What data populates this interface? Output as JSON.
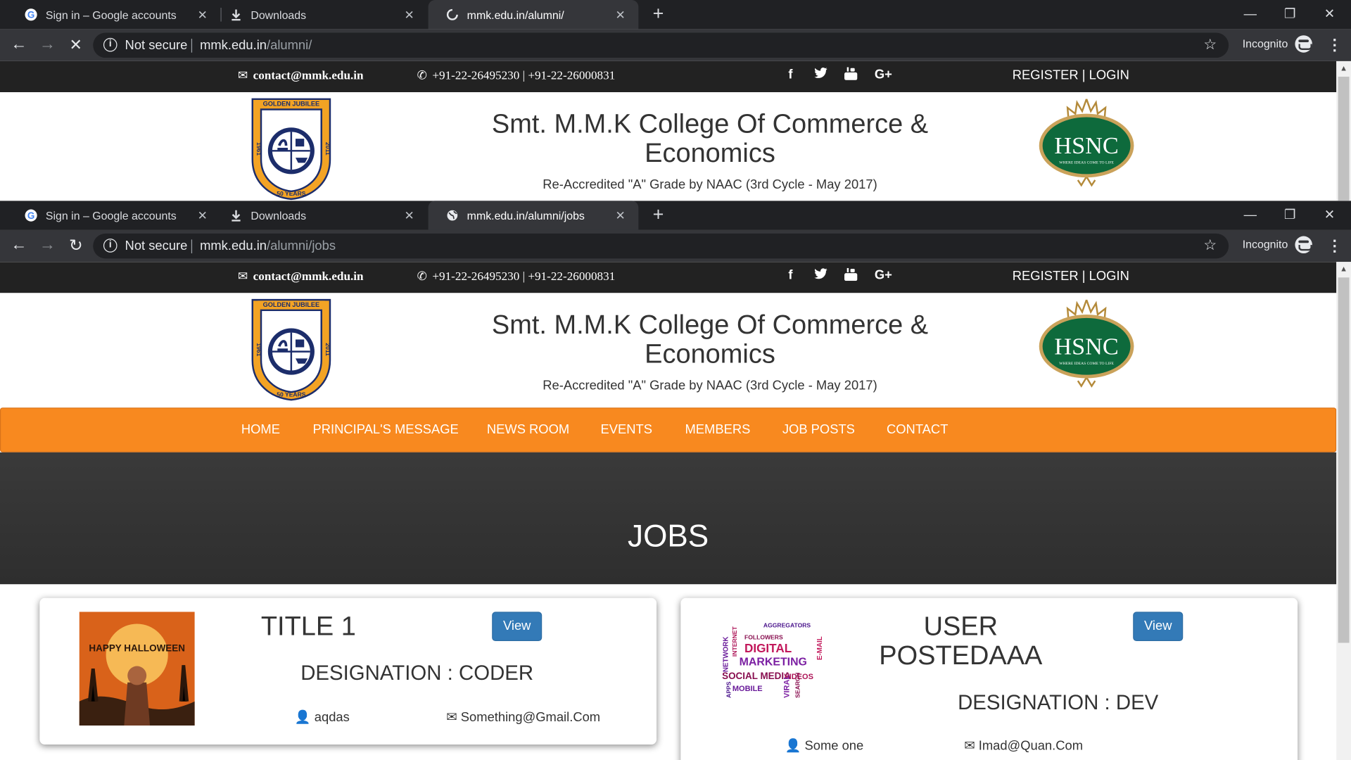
{
  "windows": [
    {
      "tabs": [
        {
          "title": "Sign in – Google accounts",
          "icon": "google-icon"
        },
        {
          "title": "Downloads",
          "icon": "download-icon"
        },
        {
          "title": "mmk.edu.in/alumni/",
          "icon": "loading-spinner-icon"
        }
      ],
      "omnibox": {
        "security": "Not secure",
        "host": "mmk.edu.in",
        "path": "/alumni/"
      },
      "incognito_label": "Incognito"
    },
    {
      "tabs": [
        {
          "title": "Sign in – Google accounts",
          "icon": "google-icon"
        },
        {
          "title": "Downloads",
          "icon": "download-icon"
        },
        {
          "title": "mmk.edu.in/alumni/jobs",
          "icon": "globe-icon"
        }
      ],
      "omnibox": {
        "security": "Not secure",
        "host": "mmk.edu.in",
        "path": "/alumni/jobs"
      },
      "incognito_label": "Incognito"
    }
  ],
  "site": {
    "contact_email": "contact@mmk.edu.in",
    "contact_phone": "+91-22-26495230 | +91-22-26000831",
    "social": [
      "f",
      "facebook-icon",
      "twitter-icon",
      "youtube-icon",
      "google-plus-icon"
    ],
    "register": "REGISTER",
    "separator": " | ",
    "login": "LOGIN",
    "college_title": "Smt. M.M.K College Of Commerce & Economics",
    "accreditation": "Re-Accredited \"A\" Grade by NAAC (3rd Cycle - May 2017)",
    "crest_text": {
      "top": "GOLDEN JUBILEE",
      "left": "1961",
      "right": "2011",
      "bottom": "50 YEARS"
    },
    "hsnc_logo": {
      "main": "HSNC",
      "tagline": "WHERE IDEAS COME TO LIFE"
    },
    "nav": [
      "HOME",
      "PRINCIPAL'S MESSAGE",
      "NEWS ROOM",
      "EVENTS",
      "MEMBERS",
      "JOB POSTS",
      "CONTACT"
    ],
    "hero_title": "JOBS",
    "jobs": [
      {
        "title": "TITLE 1",
        "view_label": "View",
        "designation": "DESIGNATION : CODER",
        "user": "aqdas",
        "email": "Something@Gmail.Com",
        "image": {
          "type": "halloween-poster",
          "text": "HAPPY HALLOWEEN"
        }
      },
      {
        "title": "USER POSTEDAAA",
        "view_label": "View",
        "designation": "DESIGNATION : DEV",
        "user": "Some one",
        "email": "Imad@Quan.Com",
        "image": {
          "type": "word-cloud",
          "words": [
            "DIGITAL",
            "MARKETING",
            "SOCIAL MEDIA",
            "MOBILE",
            "VIDEOS",
            "AGGREGATORS",
            "FOLLOWERS",
            "NETWORK",
            "INTERNET",
            "E-MAIL",
            "APPS",
            "VIRAL",
            "SEARCH"
          ]
        }
      }
    ]
  },
  "colors": {
    "nav_orange": "#f8891f",
    "topbar": "#222222",
    "hero": "#333333",
    "button_blue": "#337ab7",
    "hsnc_green": "#0e6a3c"
  }
}
